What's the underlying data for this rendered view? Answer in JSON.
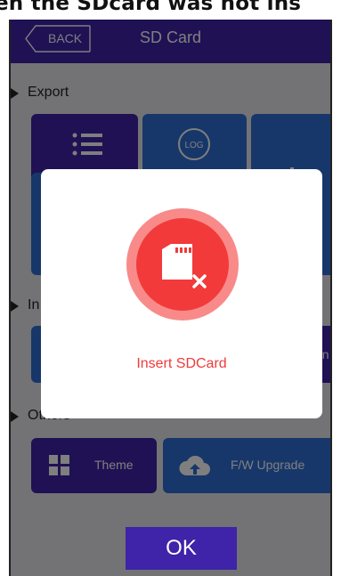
{
  "caption": {
    "text": "en the SDcard was not ins"
  },
  "header": {
    "back_label": "BACK",
    "title": "SD Card"
  },
  "sections": {
    "export": "Export",
    "import_partial": "In",
    "others": "Others"
  },
  "tiles": {
    "log_icon_text": "LOG",
    "partial_label": "on",
    "theme": "Theme",
    "fw_upgrade": "F/W Upgrade"
  },
  "dialog": {
    "message": "Insert SDCard"
  },
  "ok_label": "OK",
  "colors": {
    "primary_purple": "#3f23a8",
    "tile_blue": "#2f6fd4",
    "error_red": "#f03a3a",
    "overlay_bg": "#e7e7eb"
  }
}
